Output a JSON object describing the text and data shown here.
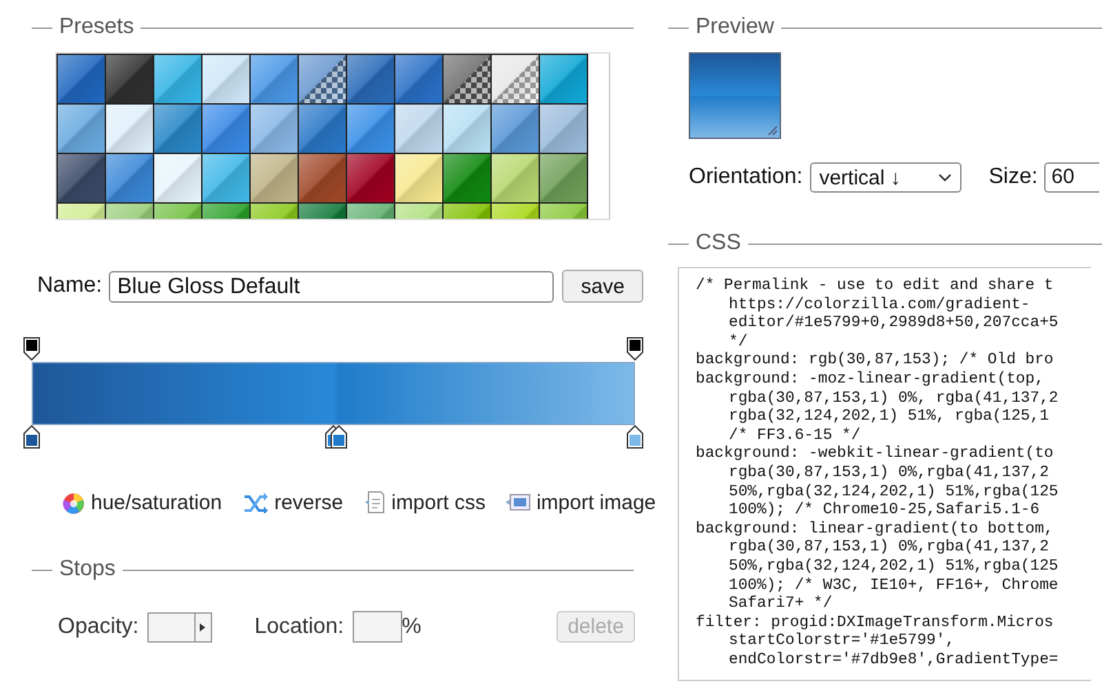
{
  "presets": {
    "title": "Presets",
    "swatches": [
      {
        "color": "#2068c0",
        "transparent": false
      },
      {
        "color": "#303030",
        "transparent": false
      },
      {
        "color": "#35b6e8",
        "transparent": false
      },
      {
        "color": "#cfe8fa",
        "transparent": false
      },
      {
        "color": "#4a98e8",
        "transparent": false
      },
      {
        "color": "#6a98d0",
        "transparent": true
      },
      {
        "color": "#2a6ab8",
        "transparent": false
      },
      {
        "color": "#2a70c8",
        "transparent": false
      },
      {
        "color": "#707070",
        "transparent": true
      },
      {
        "color": "#e8e8e8",
        "transparent": true
      },
      {
        "color": "#10a8d8",
        "transparent": false
      },
      {
        "color": "#6aaae0",
        "transparent": false
      },
      {
        "color": "#e0f0fa",
        "transparent": false
      },
      {
        "color": "#2a88c8",
        "transparent": false
      },
      {
        "color": "#3a8ae8",
        "transparent": false
      },
      {
        "color": "#8ab8e8",
        "transparent": false
      },
      {
        "color": "#2a78c8",
        "transparent": false
      },
      {
        "color": "#3a90e8",
        "transparent": false
      },
      {
        "color": "#c0d8ee",
        "transparent": false
      },
      {
        "color": "#b8e0f4",
        "transparent": false
      },
      {
        "color": "#5a98d8",
        "transparent": false
      },
      {
        "color": "#9cbcdc",
        "transparent": false
      },
      {
        "color": "#3a4a68",
        "transparent": false
      },
      {
        "color": "#3a88d8",
        "transparent": false
      },
      {
        "color": "#e8f6fc",
        "transparent": false
      },
      {
        "color": "#40b8e8",
        "transparent": false
      },
      {
        "color": "#c0b488",
        "transparent": false
      },
      {
        "color": "#a04828",
        "transparent": false
      },
      {
        "color": "#a00020",
        "transparent": false
      },
      {
        "color": "#f8e890",
        "transparent": false
      },
      {
        "color": "#108810",
        "transparent": false
      },
      {
        "color": "#b8d870",
        "transparent": false
      },
      {
        "color": "#70a058",
        "transparent": false
      },
      {
        "color": "#d0ec90",
        "transparent": false
      },
      {
        "color": "#98cc78",
        "transparent": false
      },
      {
        "color": "#70c040",
        "transparent": false
      },
      {
        "color": "#28a028",
        "transparent": false
      },
      {
        "color": "#88c818",
        "transparent": false
      },
      {
        "color": "#107838",
        "transparent": false
      },
      {
        "color": "#60b070",
        "transparent": false
      },
      {
        "color": "#b0e080",
        "transparent": false
      },
      {
        "color": "#80c000",
        "transparent": false
      },
      {
        "color": "#a8d818",
        "transparent": false
      },
      {
        "color": "#88c838",
        "transparent": false
      }
    ]
  },
  "name_field": {
    "label": "Name:",
    "value": "Blue Gloss Default"
  },
  "save_button": "save",
  "gradient": {
    "opacity_stops": [
      {
        "level": 0
      },
      {
        "level": 1
      }
    ],
    "color_stops": [
      {
        "color": "#1e5799",
        "level": 0
      },
      {
        "color": "#2989d8",
        "level": 0.5
      },
      {
        "color": "#207cca",
        "level": 0.51
      },
      {
        "color": "#7db9e8",
        "level": 1
      }
    ]
  },
  "tools": [
    {
      "kind": "hue",
      "label": "hue/saturation"
    },
    {
      "kind": "reverse",
      "label": "reverse"
    },
    {
      "kind": "css",
      "label": "import css"
    },
    {
      "kind": "image",
      "label": "import image"
    }
  ],
  "stops": {
    "title": "Stops",
    "opacity_label": "Opacity:",
    "location_label": "Location:",
    "percent": "%",
    "delete_button": {
      "label": "delete",
      "disabled": true
    }
  },
  "preview": {
    "title": "Preview",
    "orientation_label": "Orientation:",
    "orientation": "vertical ↓",
    "size_label": "Size:",
    "size": "60"
  },
  "css": {
    "title": "CSS",
    "lines": [
      {
        "text": "/* Permalink - use to edit and share t",
        "indent": false
      },
      {
        "text": "https://colorzilla.com/gradient-",
        "indent": true
      },
      {
        "text": "editor/#1e5799+0,2989d8+50,207cca+5",
        "indent": true
      },
      {
        "text": "*/",
        "indent": true
      },
      {
        "text": "background: rgb(30,87,153); /* Old bro",
        "indent": false
      },
      {
        "text": "background: -moz-linear-gradient(top,",
        "indent": false
      },
      {
        "text": "rgba(30,87,153,1) 0%, rgba(41,137,2",
        "indent": true
      },
      {
        "text": "rgba(32,124,202,1) 51%, rgba(125,1",
        "indent": true
      },
      {
        "text": "/* FF3.6-15 */",
        "indent": true
      },
      {
        "text": "background: -webkit-linear-gradient(to",
        "indent": false
      },
      {
        "text": "rgba(30,87,153,1) 0%,rgba(41,137,2",
        "indent": true
      },
      {
        "text": "50%,rgba(32,124,202,1) 51%,rgba(125",
        "indent": true
      },
      {
        "text": "100%); /* Chrome10-25,Safari5.1-6",
        "indent": true
      },
      {
        "text": "background: linear-gradient(to bottom,",
        "indent": false
      },
      {
        "text": "rgba(30,87,153,1) 0%,rgba(41,137,2",
        "indent": true
      },
      {
        "text": "50%,rgba(32,124,202,1) 51%,rgba(125",
        "indent": true
      },
      {
        "text": "100%); /* W3C, IE10+, FF16+, Chrome",
        "indent": true
      },
      {
        "text": "Safari7+ */",
        "indent": true
      },
      {
        "text": "filter: progid:DXImageTransform.Micros",
        "indent": false
      },
      {
        "text": "startColorstr='#1e5799',",
        "indent": true
      },
      {
        "text": "endColorstr='#7db9e8',GradientType=",
        "indent": true
      }
    ]
  }
}
